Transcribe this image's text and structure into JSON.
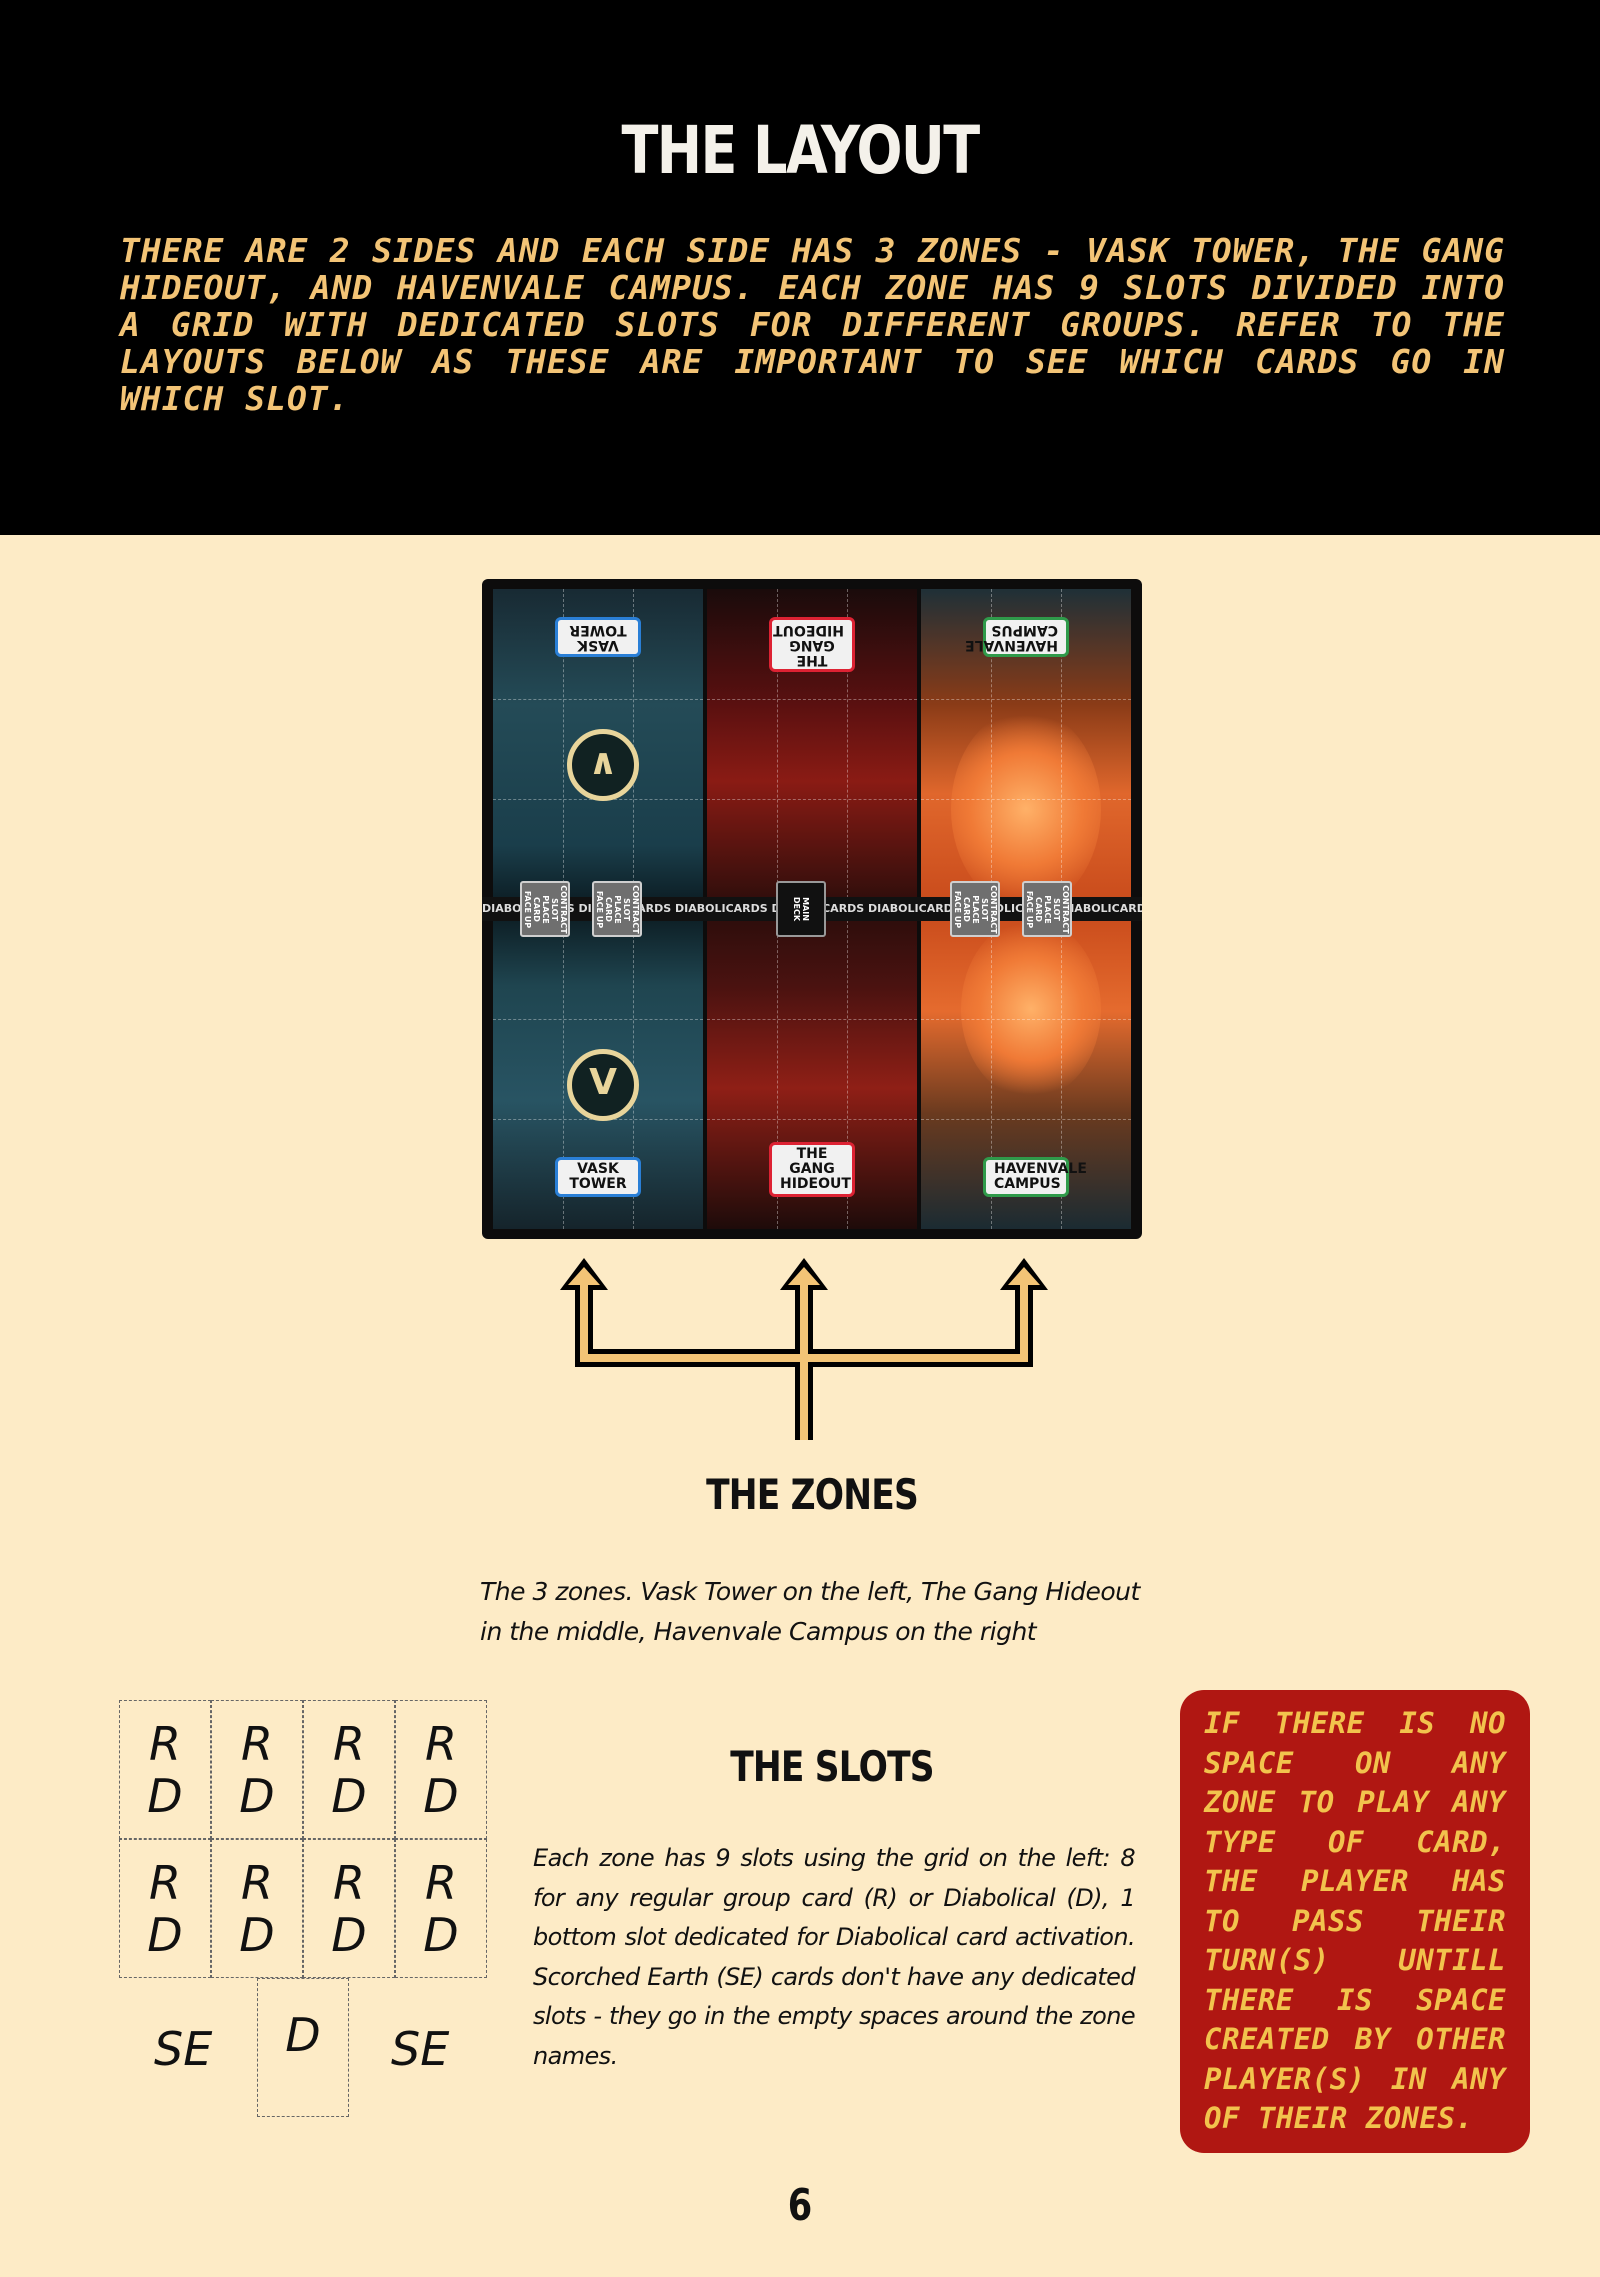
{
  "header": {
    "title": "THE LAYOUT",
    "intro": "There are 2 sides and each side has 3 zones - Vask Tower, The Gang Hideout, and Havenvale Campus. Each zone has 9 slots divided into a grid with dedicated slots for different groups. Refer to the layouts below as these are important to see which cards go in which slot."
  },
  "board": {
    "zones": [
      {
        "label": "VASK\nTOWER",
        "emblem": "V"
      },
      {
        "label": "THE GANG\nHIDEOUT",
        "emblem": ""
      },
      {
        "label": "HAVENVALE\nCAMPUS",
        "emblem": ""
      }
    ],
    "midstrip_text": "DIABOLICARDS DIABOLICARDS DIABOLICARDS DIABOLICARDS DIABOLICARDS DIABOLICARDS DIABOLICARDS DIABOLICARDS",
    "contract_slot_label": "CONTRACT\nSLOT\nPLACE CARD\nFACE UP",
    "main_deck_label": "MAIN\nDECK"
  },
  "zones_section": {
    "heading": "THE ZONES",
    "caption": "The 3 zones. Vask Tower on the left, The Gang Hideout in the middle, Havenvale Campus on the right"
  },
  "slots_section": {
    "heading": "THE SLOTS",
    "text": "Each zone has 9 slots using the grid on the left: 8 for any regular group card (R) or Diabolical (D), 1 bottom slot dedicated for Diabolical card activation. Scorched Earth (SE) cards don't have any dedicated slots - they go in the empty spaces around the zone names.",
    "grid": {
      "slot_label": "R\nD",
      "bottom_slot_label": "D",
      "side_label": "SE"
    }
  },
  "callout": {
    "text": "If there is no space on any zone to play any type of card, the player has to pass their turn(s) untill there is space created by other player(s) in any of their zones."
  },
  "page_number": "6",
  "colors": {
    "page_bg": "#fdebc6",
    "header_bg": "#000000",
    "intro_text": "#f3c476",
    "callout_bg": "#b01712",
    "callout_text": "#f2c34d"
  }
}
